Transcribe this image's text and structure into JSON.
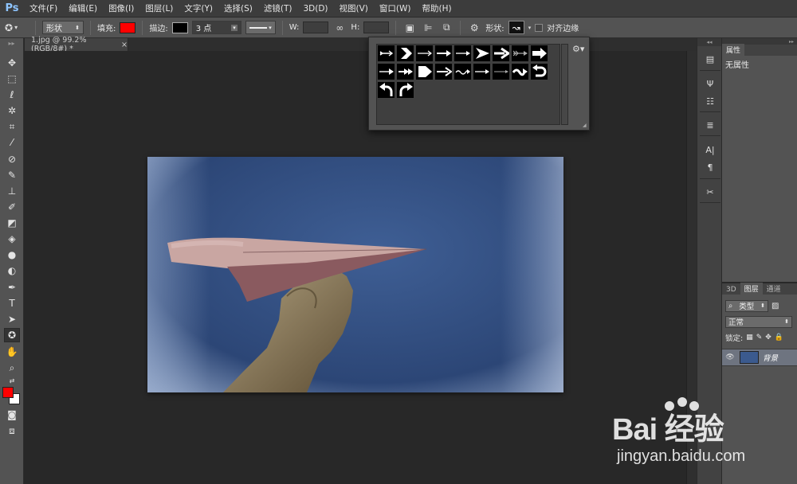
{
  "app": {
    "logo": "Ps",
    "menu": [
      "文件(F)",
      "编辑(E)",
      "图像(I)",
      "图层(L)",
      "文字(Y)",
      "选择(S)",
      "滤镜(T)",
      "3D(D)",
      "视图(V)",
      "窗口(W)",
      "帮助(H)"
    ]
  },
  "options": {
    "mode": "形状",
    "fill_label": "填充:",
    "fill_color": "#ff0000",
    "stroke_label": "描边:",
    "stroke_color": "#000000",
    "stroke_width": "3 点",
    "width_label": "W:",
    "height_label": "H:",
    "shape_label": "形状:",
    "align_label": "对齐边缘"
  },
  "document": {
    "tab_title": "1.jpg @ 99.2%(RGB/8#) *",
    "close": "×"
  },
  "colors": {
    "foreground": "#ff0000",
    "background": "#ffffff"
  },
  "shape_picker": {
    "rows": [
      [
        "arrow-feathered-1",
        "chevron-arrow",
        "arrow-thin-long",
        "arrow-feathered-2",
        "arrow-simple",
        "arrow-triangle-large",
        "arrow-bold",
        "arrow-feathered-3",
        "arrow-block"
      ],
      [
        "arrow-feathered-4",
        "arrow-double-head",
        "arrow-pentagon",
        "arrow-medium",
        "arrow-wavy",
        "arrow-dashed",
        "arrow-tiny-head",
        "arrow-wave-bold",
        "arrow-u-turn"
      ],
      [
        "arrow-curved-left",
        "arrow-curved-right"
      ]
    ]
  },
  "properties_panel": {
    "tab": "属性",
    "content": "无属性"
  },
  "layers_panel": {
    "tabs": [
      "3D",
      "图层",
      "通道"
    ],
    "filter_kind": "类型",
    "blend_mode": "正常",
    "lock_label": "锁定:",
    "layer_name": "背景"
  },
  "watermark": {
    "line1": "Bai 经验",
    "line2": "jingyan.baidu.com"
  }
}
